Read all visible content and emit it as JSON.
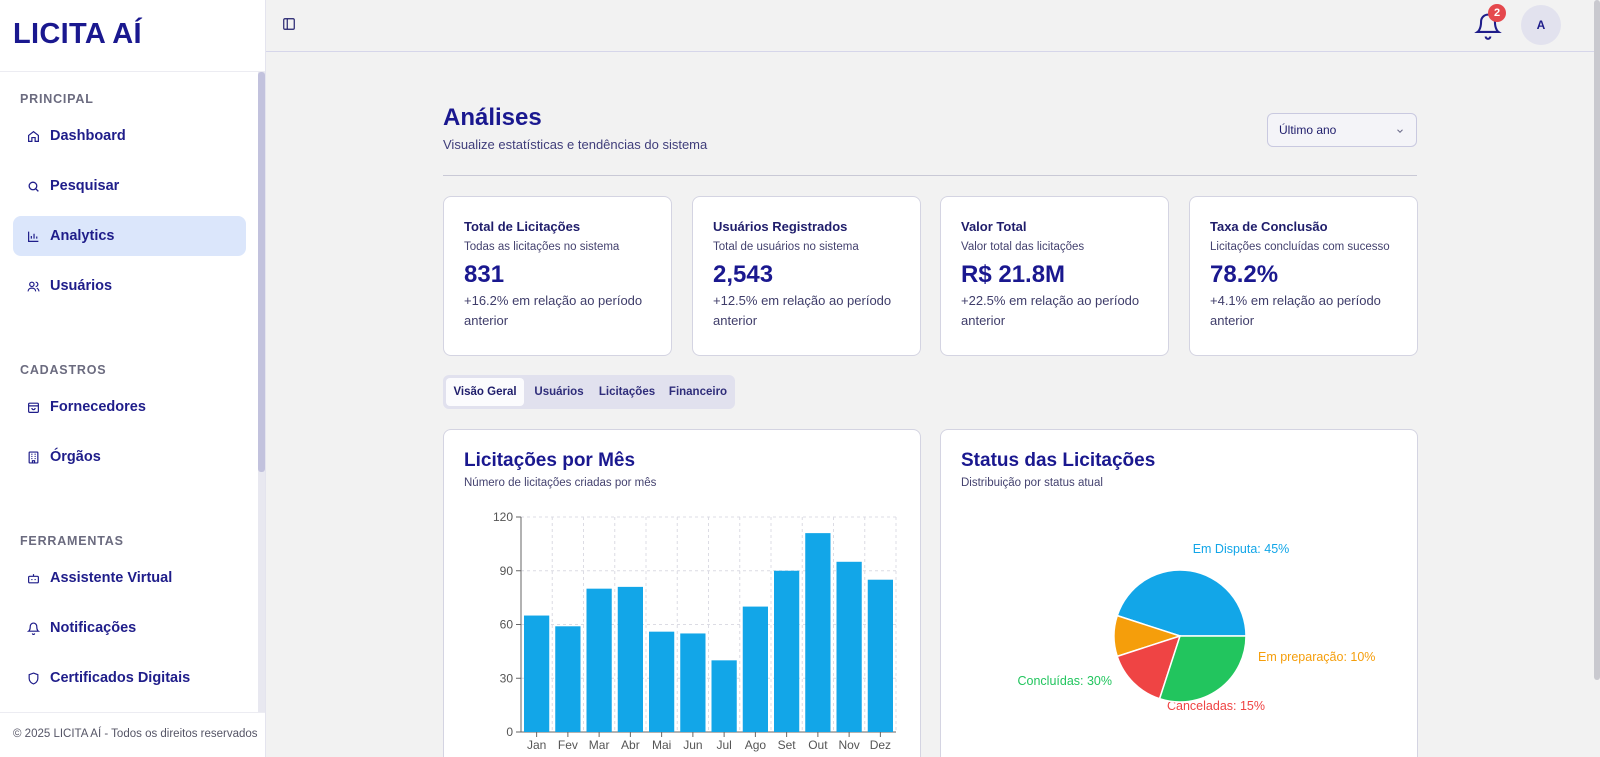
{
  "brand": {
    "name": "LICITA AÍ"
  },
  "sidebar": {
    "sections": [
      {
        "title": "PRINCIPAL"
      },
      {
        "title": "CADASTROS"
      },
      {
        "title": "FERRAMENTAS"
      }
    ],
    "items": [
      {
        "label": "Dashboard",
        "icon": "home-icon"
      },
      {
        "label": "Pesquisar",
        "icon": "search-icon"
      },
      {
        "label": "Analytics",
        "icon": "bar-chart-icon",
        "active": true
      },
      {
        "label": "Usuários",
        "icon": "users-icon"
      },
      {
        "label": "Fornecedores",
        "icon": "shopping-bag-icon"
      },
      {
        "label": "Órgãos",
        "icon": "building-icon"
      },
      {
        "label": "Assistente Virtual",
        "icon": "bot-icon"
      },
      {
        "label": "Notificações",
        "icon": "bell-icon"
      },
      {
        "label": "Certificados Digitais",
        "icon": "shield-icon"
      }
    ],
    "footer": "© 2025 LICITA AÍ - Todos os direitos reservados"
  },
  "header": {
    "notification_count": "2",
    "avatar_initial": "A"
  },
  "page": {
    "title": "Análises",
    "subtitle": "Visualize estatísticas e tendências do sistema",
    "period_select": "Último ano"
  },
  "stats": [
    {
      "title": "Total de Licitações",
      "desc": "Todas as licitações no sistema",
      "value": "831",
      "change": "+16.2% em relação ao período anterior"
    },
    {
      "title": "Usuários Registrados",
      "desc": "Total de usuários no sistema",
      "value": "2,543",
      "change": "+12.5% em relação ao período anterior"
    },
    {
      "title": "Valor Total",
      "desc": "Valor total das licitações",
      "value": "R$ 21.8M",
      "change": "+22.5% em relação ao período anterior"
    },
    {
      "title": "Taxa de Conclusão",
      "desc": "Licitações concluídas com sucesso",
      "value": "78.2%",
      "change": "+4.1% em relação ao período anterior"
    }
  ],
  "tabs": [
    {
      "label": "Visão Geral",
      "active": true
    },
    {
      "label": "Usuários"
    },
    {
      "label": "Licitações"
    },
    {
      "label": "Financeiro"
    }
  ],
  "charts": {
    "bar": {
      "title": "Licitações por Mês",
      "subtitle": "Número de licitações criadas por mês"
    },
    "pie": {
      "title": "Status das Licitações",
      "subtitle": "Distribuição por status atual"
    }
  },
  "chart_data": [
    {
      "type": "bar",
      "categories": [
        "Jan",
        "Fev",
        "Mar",
        "Abr",
        "Mai",
        "Jun",
        "Jul",
        "Ago",
        "Set",
        "Out",
        "Nov",
        "Dez"
      ],
      "values": [
        65,
        59,
        80,
        81,
        56,
        55,
        40,
        70,
        90,
        111,
        95,
        85
      ],
      "ylim": [
        0,
        120
      ],
      "yticks": [
        0,
        30,
        60,
        90,
        120
      ],
      "grid": true,
      "color": "#12a6e8"
    },
    {
      "type": "pie",
      "slices": [
        {
          "label": "Em Disputa: 45%",
          "value": 45,
          "color": "#12a6e8"
        },
        {
          "label": "Em preparação: 10%",
          "value": 10,
          "color": "#f59e0b"
        },
        {
          "label": "Canceladas: 15%",
          "value": 15,
          "color": "#ef4444"
        },
        {
          "label": "Concluídas: 30%",
          "value": 30,
          "color": "#22c55e"
        }
      ]
    }
  ]
}
